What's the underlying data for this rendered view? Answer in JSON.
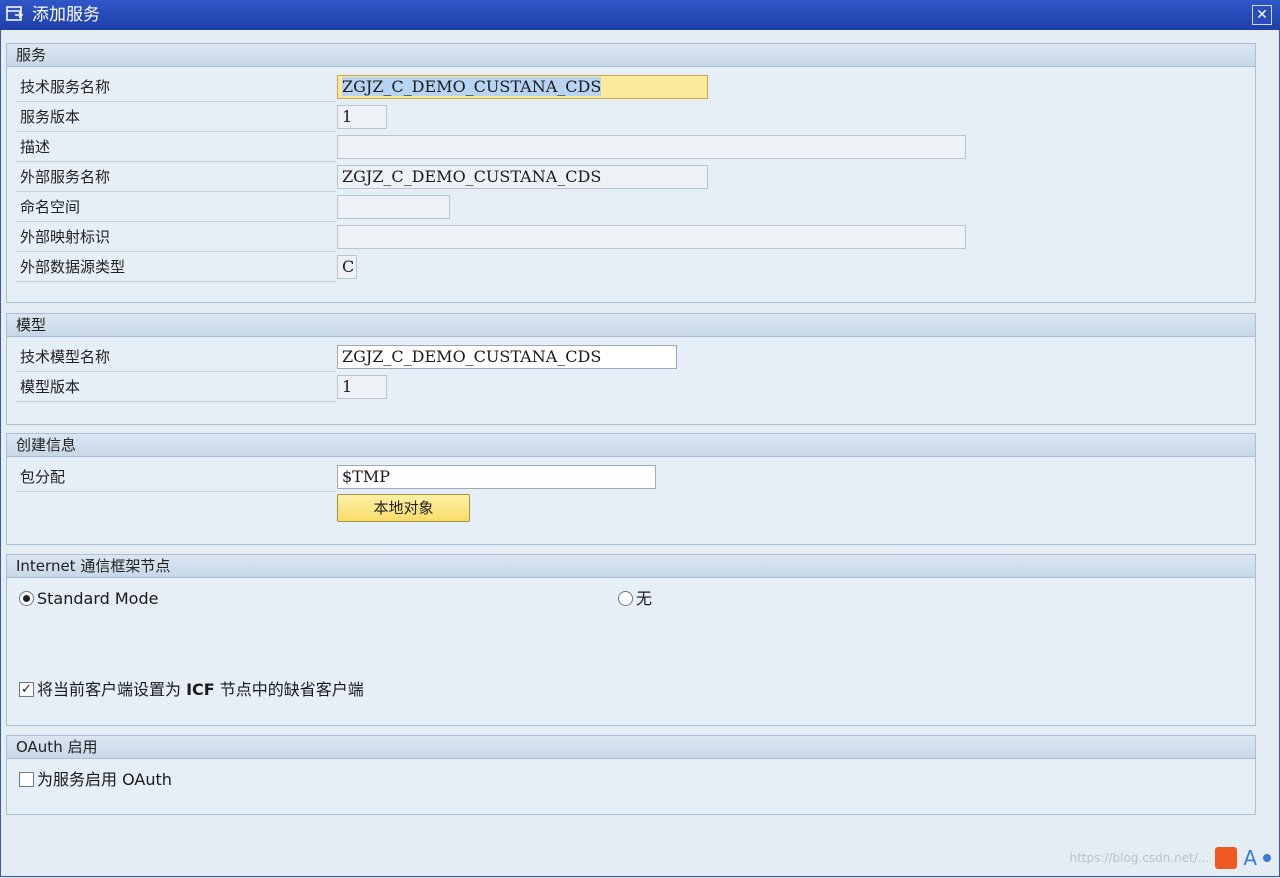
{
  "window": {
    "title": "添加服务",
    "close_label": "✕"
  },
  "service": {
    "header": "服务",
    "tech_name_label": "技术服务名称",
    "tech_name_value": "ZGJZ_C_DEMO_CUSTANA_CDS",
    "version_label": "服务版本",
    "version_value": "1",
    "desc_label": "描述",
    "desc_value": "",
    "ext_name_label": "外部服务名称",
    "ext_name_value": "ZGJZ_C_DEMO_CUSTANA_CDS",
    "namespace_label": "命名空间",
    "namespace_value": "",
    "ext_map_label": "外部映射标识",
    "ext_map_value": "",
    "ext_src_label": "外部数据源类型",
    "ext_src_value": "C"
  },
  "model": {
    "header": "模型",
    "tech_name_label": "技术模型名称",
    "tech_name_value": "ZGJZ_C_DEMO_CUSTANA_CDS",
    "version_label": "模型版本",
    "version_value": "1"
  },
  "creation": {
    "header": "创建信息",
    "package_label": "包分配",
    "package_value": "$TMP",
    "local_button": "本地对象"
  },
  "icf": {
    "header_latin": "Internet",
    "header_cn": " 通信框架节点",
    "option_standard": "Standard Mode",
    "option_none": "无",
    "standard_selected": true,
    "default_client_label_a": "将当前客户端设置为 ",
    "default_client_label_b": "ICF",
    "default_client_label_c": " 节点中的缺省客户端",
    "default_client_checked": true,
    "check_mark": "✓"
  },
  "oauth": {
    "header_latin": "OAuth",
    "header_cn": " 启用",
    "enable_label_a": "为服务启用 ",
    "enable_label_b": "OAuth",
    "enable_checked": false
  },
  "watermark": {
    "text": "https://blog.csdn.net/...",
    "letter": "A"
  }
}
